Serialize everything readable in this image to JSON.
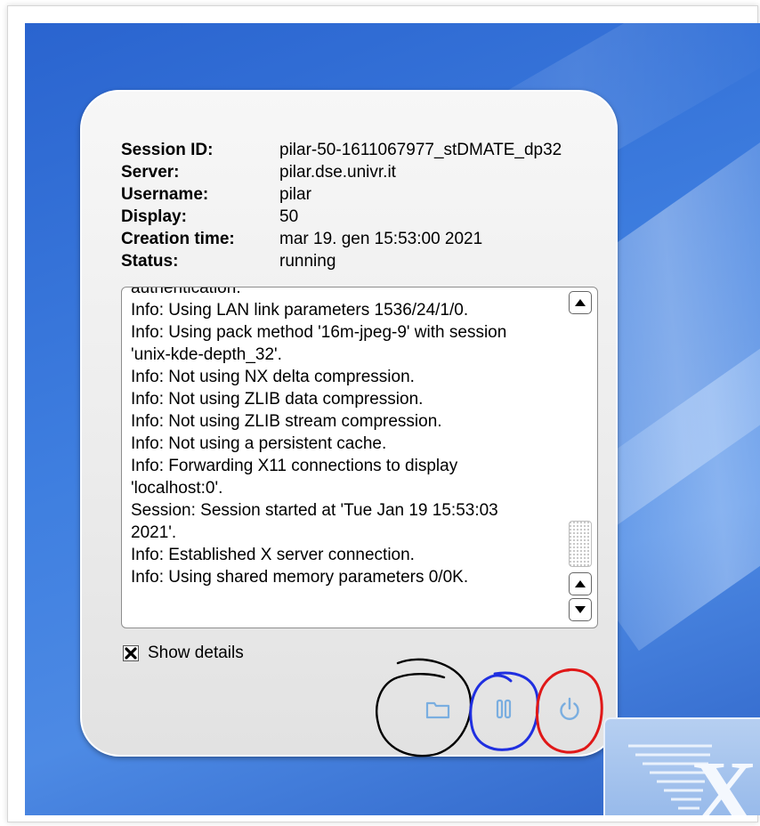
{
  "session": {
    "labels": {
      "session_id": "Session ID:",
      "server": "Server:",
      "username": "Username:",
      "display": "Display:",
      "creation_time": "Creation time:",
      "status": "Status:"
    },
    "values": {
      "session_id": "pilar-50-1611067977_stDMATE_dp32",
      "server": "pilar.dse.univr.it",
      "username": "pilar",
      "display": "50",
      "creation_time": "mar 19. gen 15:53:00 2021",
      "status": "running"
    }
  },
  "log": {
    "lines": [
      "authentication.",
      "Info: Using LAN link parameters 1536/24/1/0.",
      "Info: Using pack method '16m-jpeg-9' with session",
      "'unix-kde-depth_32'.",
      "Info: Not using NX delta compression.",
      "Info: Not using ZLIB data compression.",
      "Info: Not using ZLIB stream compression.",
      "Info: Not using a persistent cache.",
      "Info: Forwarding X11 connections to display",
      "'localhost:0'.",
      "Session: Session started at 'Tue Jan 19 15:53:03",
      "2021'.",
      "Info: Established X server connection.",
      "Info: Using shared memory parameters 0/0K."
    ]
  },
  "details": {
    "label": "Show details",
    "checked": true
  },
  "controls": {
    "folder_icon": "folder-icon",
    "pause_icon": "pause-icon",
    "power_icon": "power-icon",
    "icon_color": "#7aaee0"
  },
  "annotations": {
    "colors": [
      "#000000",
      "#1f2fe0",
      "#e01818"
    ]
  },
  "logo": {
    "icon": "x-logo-icon",
    "letter": "X"
  }
}
